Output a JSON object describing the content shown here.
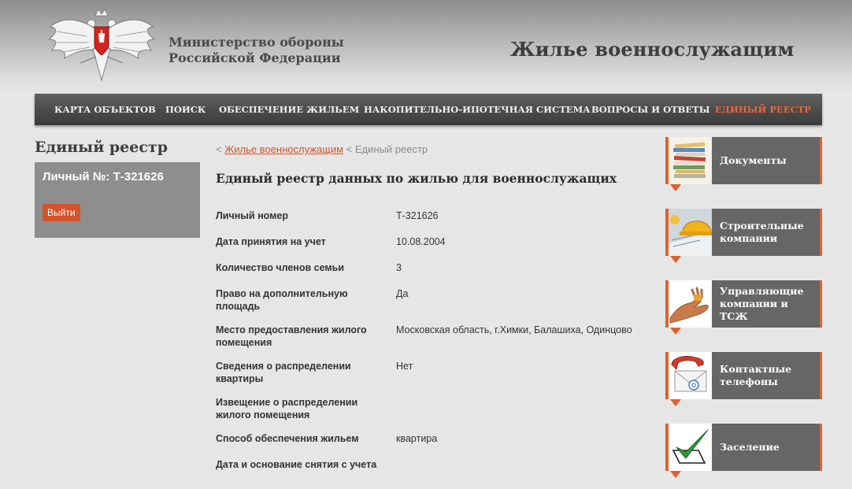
{
  "header": {
    "ministry_line1": "Министерство обороны",
    "ministry_line2": "Российской Федерации",
    "site_title": "Жилье военнослужащим"
  },
  "nav": {
    "items": [
      {
        "label": "КАРТА ОБЪЕКТОВ"
      },
      {
        "label": "ПОИСК"
      },
      {
        "label": "ОБЕСПЕЧЕНИЕ ЖИЛЬЕМ"
      },
      {
        "label": "НАКОПИТЕЛЬНО-ИПОТЕЧНАЯ СИСТЕМА"
      },
      {
        "label": "ВОПРОСЫ И ОТВЕТЫ"
      },
      {
        "label": "ЕДИНЫЙ РЕЕСТР"
      }
    ],
    "active_color": "#e8683c"
  },
  "sidebar": {
    "title": "Единый реестр",
    "user_label": "Личный №: Т-321626",
    "logout_label": "Выйти"
  },
  "breadcrumb": {
    "sep1": "<",
    "link": "Жилье военнослужащим",
    "sep2": "<",
    "current": "Единый реестр"
  },
  "content": {
    "title": "Единый реестр данных по жилью для военнослужащих",
    "rows": [
      {
        "label": "Личный номер",
        "value": "Т-321626"
      },
      {
        "label": "Дата принятия на учет",
        "value": "10.08.2004"
      },
      {
        "label": "Количество членов семьи",
        "value": "3"
      },
      {
        "label": "Право на дополнительную площадь",
        "value": "Да"
      },
      {
        "label": "Место предоставления жилого помещения",
        "value": "Московская область, г.Химки, Балашиха, Одинцово"
      },
      {
        "label": "Сведения о распределении квартиры",
        "value": "Нет"
      },
      {
        "label": "Извещение о распределении жилого помещения",
        "value": ""
      },
      {
        "label": "Способ обеспечения жильем",
        "value": "квартира"
      },
      {
        "label": "Дата и основание снятия с учета",
        "value": ""
      }
    ]
  },
  "side_cards": [
    {
      "label": "Документы",
      "icon": "documents-stack-icon"
    },
    {
      "label": "Строительные компании",
      "icon": "hard-hat-icon"
    },
    {
      "label": "Управляющие компании и ТСЖ",
      "icon": "handshake-icon"
    },
    {
      "label": "Контактные телефоны",
      "icon": "phone-mail-icon"
    },
    {
      "label": "Заселение",
      "icon": "checkmark-icon"
    }
  ],
  "colors": {
    "accent": "#e0602f",
    "nav_bg": "#4a4a4a",
    "card_bg": "#666666",
    "user_box_bg": "#8e8e8e"
  }
}
